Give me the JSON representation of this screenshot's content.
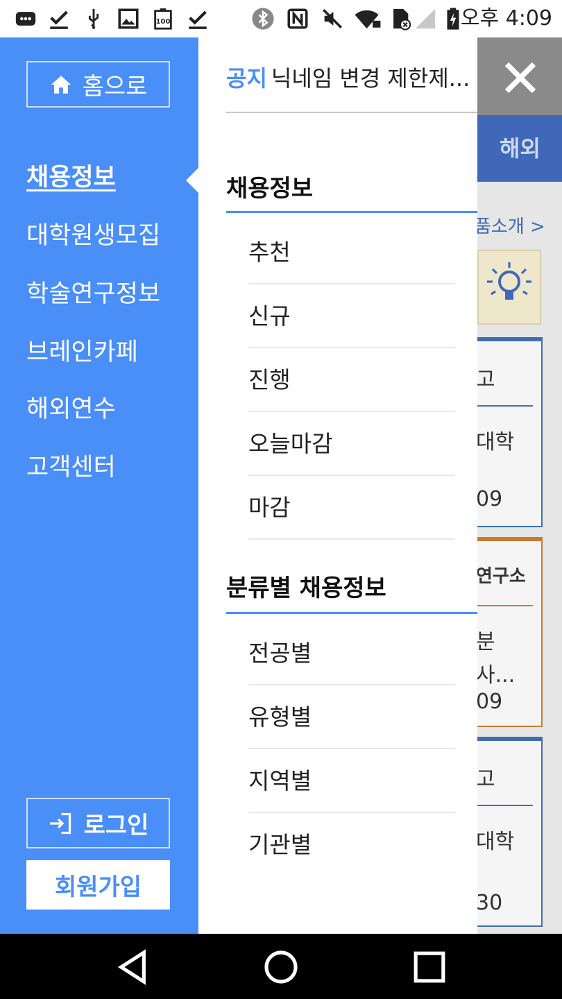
{
  "status_bar": {
    "time": "오후 4:09",
    "battery_label": "100",
    "icons": [
      "message-icon",
      "download-done-icon",
      "usb-icon",
      "image-icon",
      "battery-100-icon",
      "download-done-icon",
      "bluetooth-icon",
      "nfc-icon",
      "mute-icon",
      "wifi-lock-icon",
      "sim-off-icon",
      "signal-icon",
      "battery-charging-icon"
    ]
  },
  "sidebar": {
    "home_label": "홈으로",
    "items": [
      {
        "label": "채용정보",
        "active": true
      },
      {
        "label": "대학원생모집"
      },
      {
        "label": "학술연구정보"
      },
      {
        "label": "브레인카페"
      },
      {
        "label": "해외연수"
      },
      {
        "label": "고객센터"
      }
    ],
    "login_label": "로그인",
    "signup_label": "회원가입",
    "accent": "#4a8ef7"
  },
  "panel": {
    "notice": {
      "tag": "공지",
      "text": "닉네임 변경 제한제..."
    },
    "sections": [
      {
        "title": "채용정보",
        "items": [
          "추천",
          "신규",
          "진행",
          "오늘마감",
          "마감"
        ]
      },
      {
        "title": "분류별 채용정보",
        "items": [
          "전공별",
          "유형별",
          "지역별",
          "기관별"
        ]
      }
    ]
  },
  "background": {
    "tab_label": "해외",
    "intro_link": "품소개 >",
    "cards": [
      {
        "head": "고",
        "body": "대학",
        "date": "09"
      },
      {
        "head": "연구소",
        "body": "분",
        "body2": "사...",
        "date": "09"
      },
      {
        "head": "고",
        "body": "대학",
        "date": "30"
      }
    ]
  }
}
